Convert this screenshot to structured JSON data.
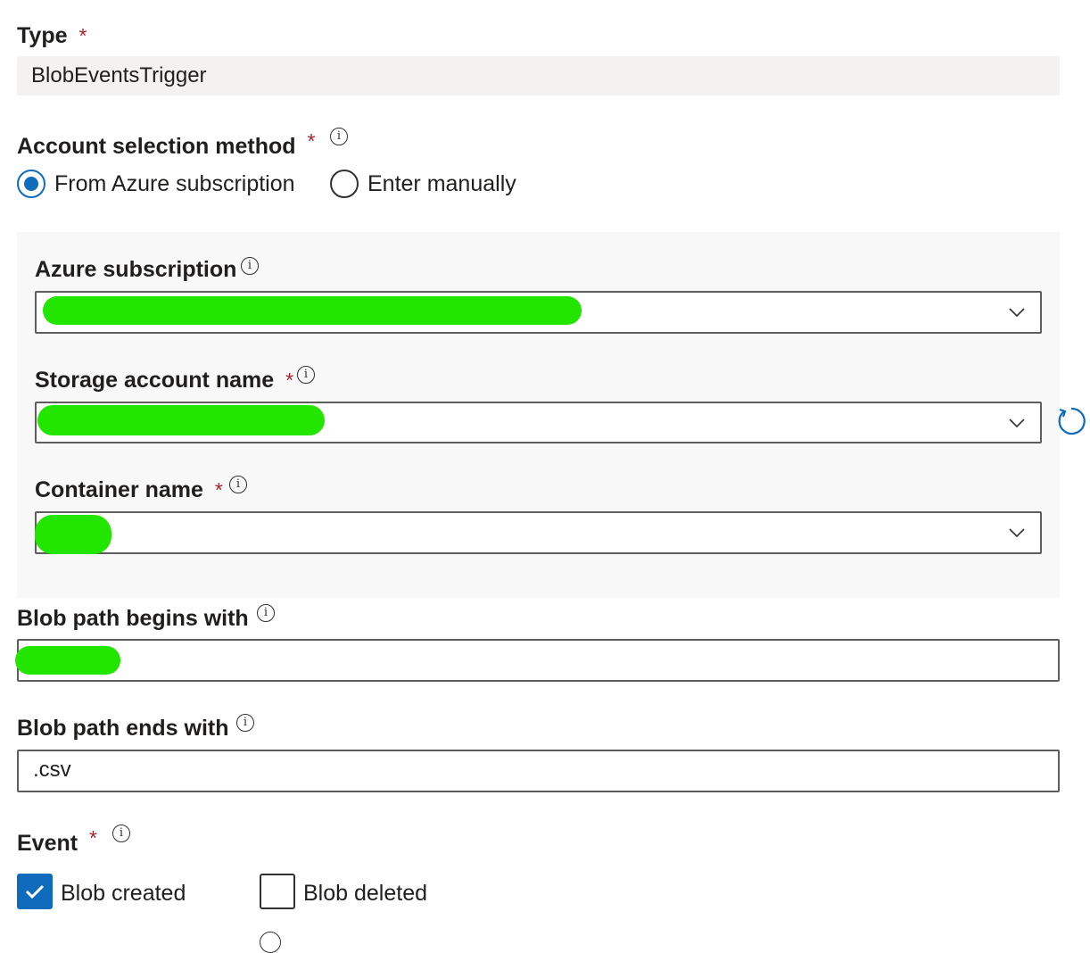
{
  "form": {
    "type": {
      "label": "Type",
      "required_mark": "*",
      "value": "BlobEventsTrigger"
    },
    "account_selection": {
      "label": "Account selection method",
      "required_mark": "*",
      "info_glyph": "i",
      "options": [
        {
          "label": "From Azure subscription",
          "selected": true
        },
        {
          "label": "Enter manually",
          "selected": false
        }
      ]
    },
    "azure_subscription": {
      "label": "Azure subscription",
      "info_glyph": "i",
      "value_redacted": true
    },
    "storage_account": {
      "label": "Storage account name",
      "required_mark": "*",
      "info_glyph": "i",
      "value_redacted": true,
      "refresh_icon": "refresh-icon"
    },
    "container": {
      "label": "Container name",
      "required_mark": "*",
      "info_glyph": "i",
      "value_redacted": true
    },
    "blob_begins": {
      "label": "Blob path begins with",
      "info_glyph": "i",
      "value_redacted": true
    },
    "blob_ends": {
      "label": "Blob path ends with",
      "info_glyph": "i",
      "value": ".csv"
    },
    "event": {
      "label": "Event",
      "required_mark": "*",
      "info_glyph": "i",
      "options": [
        {
          "label": "Blob created",
          "checked": true
        },
        {
          "label": "Blob deleted",
          "checked": false
        }
      ]
    }
  },
  "colors": {
    "accent": "#0f6cbd",
    "required": "#a4262c",
    "redaction": "#22e600",
    "readonly_bg": "#f3f2f1",
    "panel_bg": "#f8f8f8"
  }
}
